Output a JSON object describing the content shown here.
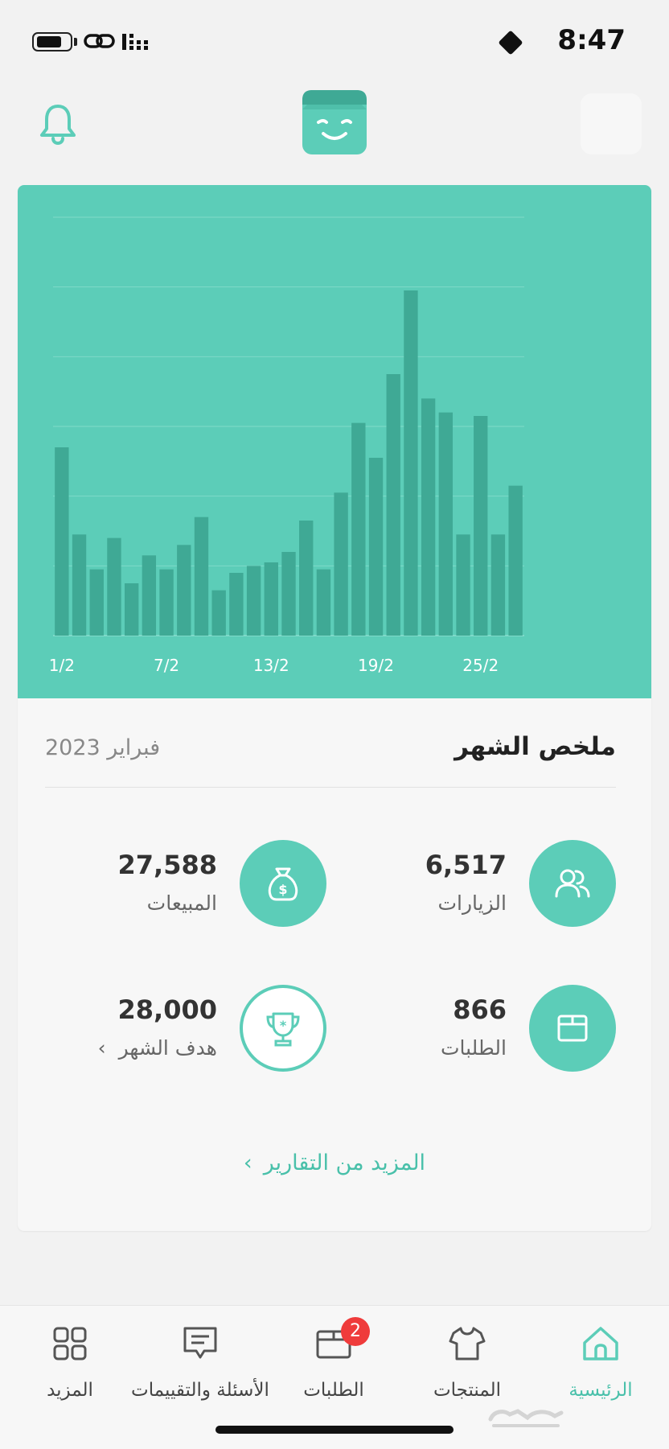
{
  "status_bar": {
    "time": "8:47"
  },
  "chart_data": {
    "type": "bar",
    "xlabel": "",
    "ylabel": "",
    "grid": true,
    "x_tick_labels": [
      "1/2",
      "7/2",
      "13/2",
      "19/2",
      "25/2"
    ],
    "values": [
      54,
      29,
      19,
      28,
      15,
      23,
      19,
      26,
      34,
      13,
      18,
      20,
      21,
      24,
      33,
      19,
      41,
      61,
      51,
      75,
      99,
      68,
      64,
      29,
      63,
      29,
      43
    ],
    "ylim": [
      0,
      120
    ],
    "colors": {
      "background": "#5ccdb8",
      "bar": "#3fa995",
      "grid": "#7fdac9",
      "tick_text": "#ffffff"
    }
  },
  "summary": {
    "title": "ملخص الشهر",
    "month": "فبراير 2023",
    "stats": [
      {
        "id": "visits",
        "value": "6,517",
        "label": "الزيارات",
        "icon": "users-icon"
      },
      {
        "id": "sales",
        "value": "27,588",
        "label": "المبيعات",
        "icon": "money-bag-icon"
      },
      {
        "id": "orders",
        "value": "866",
        "label": "الطلبات",
        "icon": "box-icon"
      },
      {
        "id": "goal",
        "value": "28,000",
        "label": "هدف الشهر",
        "icon": "trophy-icon"
      }
    ],
    "more_reports": "المزيد من التقارير"
  },
  "tabs": [
    {
      "label": "الرئيسية",
      "icon": "home-icon",
      "active": true
    },
    {
      "label": "المنتجات",
      "icon": "tshirt-icon",
      "active": false
    },
    {
      "label": "الطلبات",
      "icon": "box-icon",
      "active": false,
      "badge": "2"
    },
    {
      "label": "الأسئلة والتقييمات",
      "icon": "chat-icon",
      "active": false
    },
    {
      "label": "المزيد",
      "icon": "grid-icon",
      "active": false
    }
  ],
  "colors": {
    "accent": "#5ccdb8",
    "badge": "#ef3b3b"
  }
}
